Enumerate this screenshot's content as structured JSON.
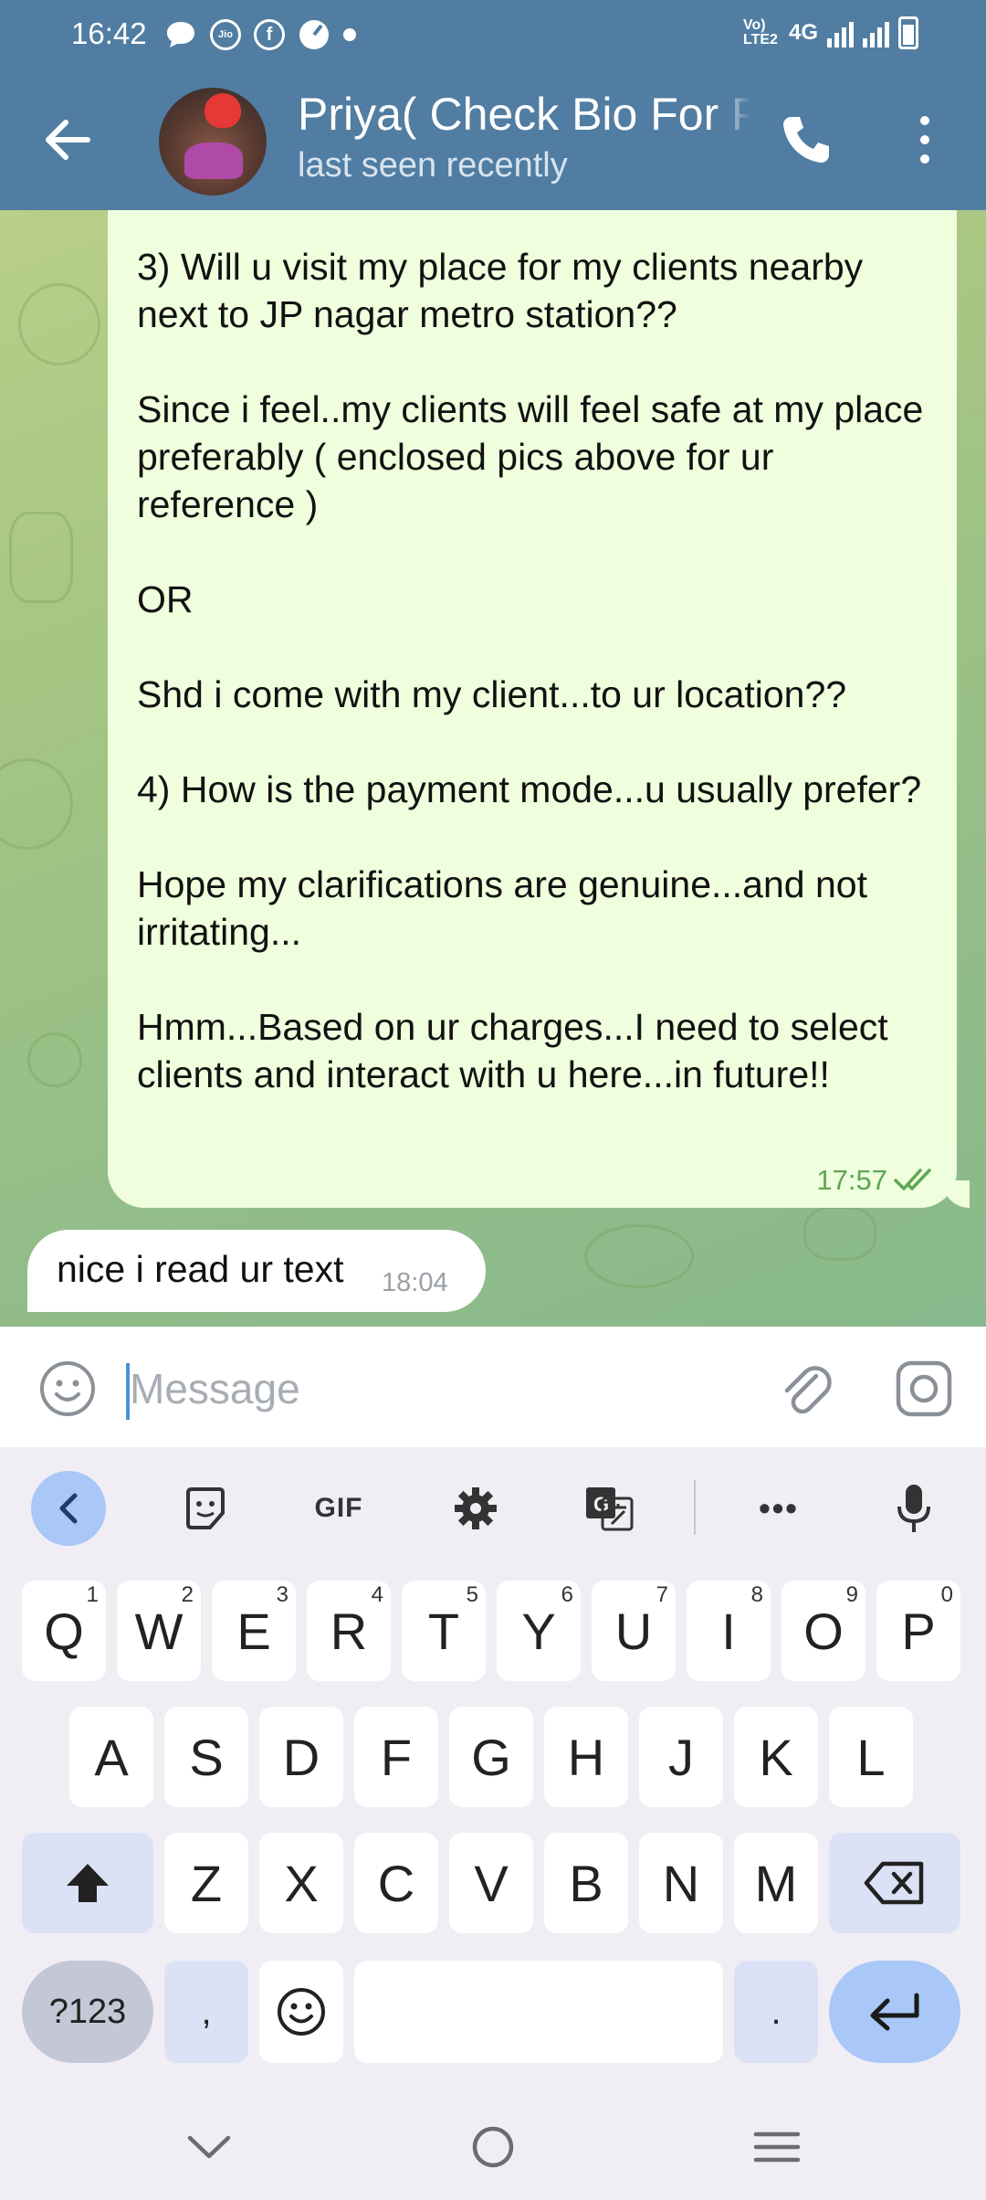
{
  "status_bar": {
    "time": "16:42",
    "network_label": "4G",
    "volte_label": "Vo) LTE2"
  },
  "header": {
    "title": "Priya( Check Bio For P",
    "subtitle": "last seen recently"
  },
  "messages": {
    "outgoing": {
      "text": "3) Will u visit my place for my clients nearby next to JP nagar metro station??\n\nSince i feel..my clients will feel safe at my place preferably ( enclosed pics above for ur reference )\n\nOR\n\nShd i come with my client...to ur location??\n\n4) How is the payment mode...u usually prefer?\n\nHope my clarifications are genuine...and not irritating...\n\nHmm...Based on ur charges...I need to select clients and interact with u here...in future!!",
      "time": "17:57"
    },
    "incoming": {
      "text": "nice i read ur text",
      "time": "18:04"
    }
  },
  "composer": {
    "placeholder": "Message"
  },
  "keyboard": {
    "gif_label": "GIF",
    "row1": [
      {
        "key": "Q",
        "hint": "1"
      },
      {
        "key": "W",
        "hint": "2"
      },
      {
        "key": "E",
        "hint": "3"
      },
      {
        "key": "R",
        "hint": "4"
      },
      {
        "key": "T",
        "hint": "5"
      },
      {
        "key": "Y",
        "hint": "6"
      },
      {
        "key": "U",
        "hint": "7"
      },
      {
        "key": "I",
        "hint": "8"
      },
      {
        "key": "O",
        "hint": "9"
      },
      {
        "key": "P",
        "hint": "0"
      }
    ],
    "row2": [
      "A",
      "S",
      "D",
      "F",
      "G",
      "H",
      "J",
      "K",
      "L"
    ],
    "row3": [
      "Z",
      "X",
      "C",
      "V",
      "B",
      "N",
      "M"
    ],
    "symbols_label": "?123",
    "comma": ",",
    "period": "."
  },
  "colors": {
    "header": "#517da2",
    "outgoing_bubble": "#effedd",
    "incoming_bubble": "#ffffff",
    "accent": "#5fa754",
    "keyboard_accent": "#a9c7f7"
  }
}
